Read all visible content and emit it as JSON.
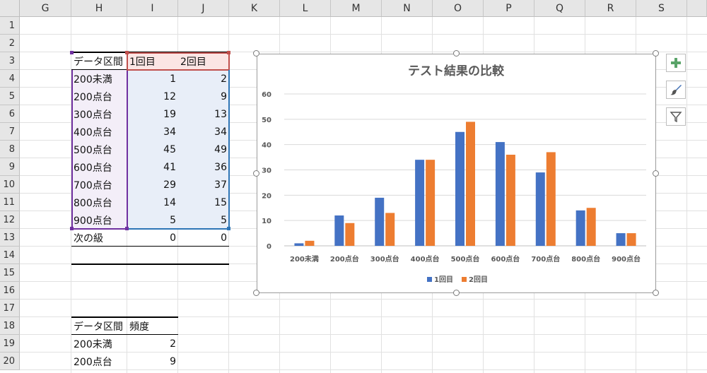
{
  "columns": [
    "G",
    "H",
    "I",
    "J",
    "K",
    "L",
    "M",
    "N",
    "O",
    "P",
    "Q",
    "R",
    "S"
  ],
  "rows": [
    "1",
    "2",
    "3",
    "4",
    "5",
    "6",
    "7",
    "8",
    "9",
    "10",
    "11",
    "12",
    "13",
    "14",
    "15",
    "16",
    "17",
    "18",
    "19",
    "20"
  ],
  "table1": {
    "header": [
      "データ区間",
      "1回目",
      "2回目"
    ],
    "rows": [
      [
        "200未満",
        "1",
        "2"
      ],
      [
        "200点台",
        "12",
        "9"
      ],
      [
        "300点台",
        "19",
        "13"
      ],
      [
        "400点台",
        "34",
        "34"
      ],
      [
        "500点台",
        "45",
        "49"
      ],
      [
        "600点台",
        "41",
        "36"
      ],
      [
        "700点台",
        "29",
        "37"
      ],
      [
        "800点台",
        "14",
        "15"
      ],
      [
        "900点台",
        "5",
        "5"
      ],
      [
        "次の級",
        "0",
        "0"
      ]
    ]
  },
  "table2": {
    "header": [
      "データ区間",
      "頻度"
    ],
    "rows": [
      [
        "200未満",
        "2"
      ],
      [
        "200点台",
        "9"
      ]
    ]
  },
  "colors": {
    "series1": "#4472c4",
    "series2": "#ed7d31",
    "range_purple": "#7030a0",
    "range_red": "#c0504d",
    "range_blue": "#2e75b6",
    "plus_icon": "#5aa469"
  },
  "chart_data": {
    "type": "bar",
    "title": "テスト結果の比較",
    "categories": [
      "200未満",
      "200点台",
      "300点台",
      "400点台",
      "500点台",
      "600点台",
      "700点台",
      "800点台",
      "900点台"
    ],
    "series": [
      {
        "name": "1回目",
        "values": [
          1,
          12,
          19,
          34,
          45,
          41,
          29,
          14,
          5
        ]
      },
      {
        "name": "2回目",
        "values": [
          2,
          9,
          13,
          34,
          49,
          36,
          37,
          15,
          5
        ]
      }
    ],
    "yticks": [
      "0",
      "10",
      "20",
      "30",
      "40",
      "50",
      "60"
    ],
    "ylim": [
      0,
      60
    ],
    "grid": true,
    "legend": "bottom"
  },
  "chart_tools": {
    "icons": [
      "plus-icon",
      "brush-icon",
      "filter-icon"
    ]
  }
}
